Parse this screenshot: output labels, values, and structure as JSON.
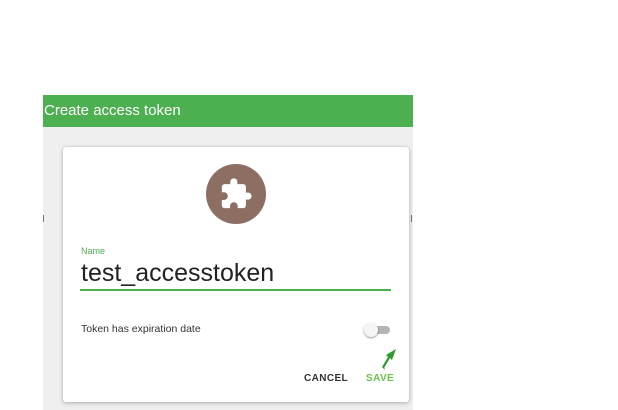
{
  "dialog": {
    "title": "Create access token",
    "header_color": "#4caf50"
  },
  "avatar": {
    "icon": "puzzle-piece-icon",
    "color": "#8d6e63"
  },
  "form": {
    "name_label": "Name",
    "name_value": "test_accesstoken",
    "expiration_label": "Token has expiration date",
    "expiration_enabled": false
  },
  "actions": {
    "cancel_label": "CANCEL",
    "save_label": "SAVE"
  },
  "colors": {
    "accent": "#4caf50",
    "save_text": "#6cc04a",
    "cursor": "#2e9d2e"
  }
}
